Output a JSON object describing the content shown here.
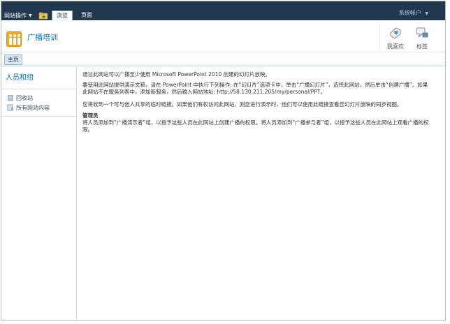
{
  "ribbon": {
    "site_actions": "网站操作",
    "tabs": [
      {
        "label": "浏览",
        "active": true
      },
      {
        "label": "页面",
        "active": false
      }
    ],
    "user": "系统帐户"
  },
  "site": {
    "title": "广播培训"
  },
  "social": {
    "like": "我喜欢",
    "tags": "标签"
  },
  "topnav": {
    "home": "主页"
  },
  "quicklaunch": {
    "heading": "人员和组",
    "items": [
      {
        "label": "回收站",
        "icon": "recycle-bin-icon"
      },
      {
        "label": "所有网站内容",
        "icon": "all-site-content-icon"
      }
    ]
  },
  "content": {
    "p1": "通过此网站可以广播至少使用 Microsoft PowerPoint 2010 创建的幻灯片放映。",
    "p2": "要使用此网站提供演示文稿，请在 PowerPoint 中执行下列操作: 在“幻灯片”选项卡中，单击“广播幻灯片”，选择此网站，然后单击“创建广播”。如果此网站不在服务列表中，添加新服务，然后输入网站地址: http://58.130.211.205/my/personal/PPT。",
    "p3": "您将收到一个可与他人共享的临时链接。如果他们有权访问此网站，则您进行演示时，他们可以使用此链接查看您幻灯片放映的同步视图。",
    "admin_title": "管理员",
    "admin_body": "将人员添加到“广播演示者”组，以授予这些人员在此网站上创建广播的权限。将人员添加到“广播参与者”组，以授予这些人员在此网站上观看广播的权限。"
  },
  "colors": {
    "ribbon_bg": "#21374c",
    "accent": "#0072bc",
    "logo": "#f5a623"
  }
}
